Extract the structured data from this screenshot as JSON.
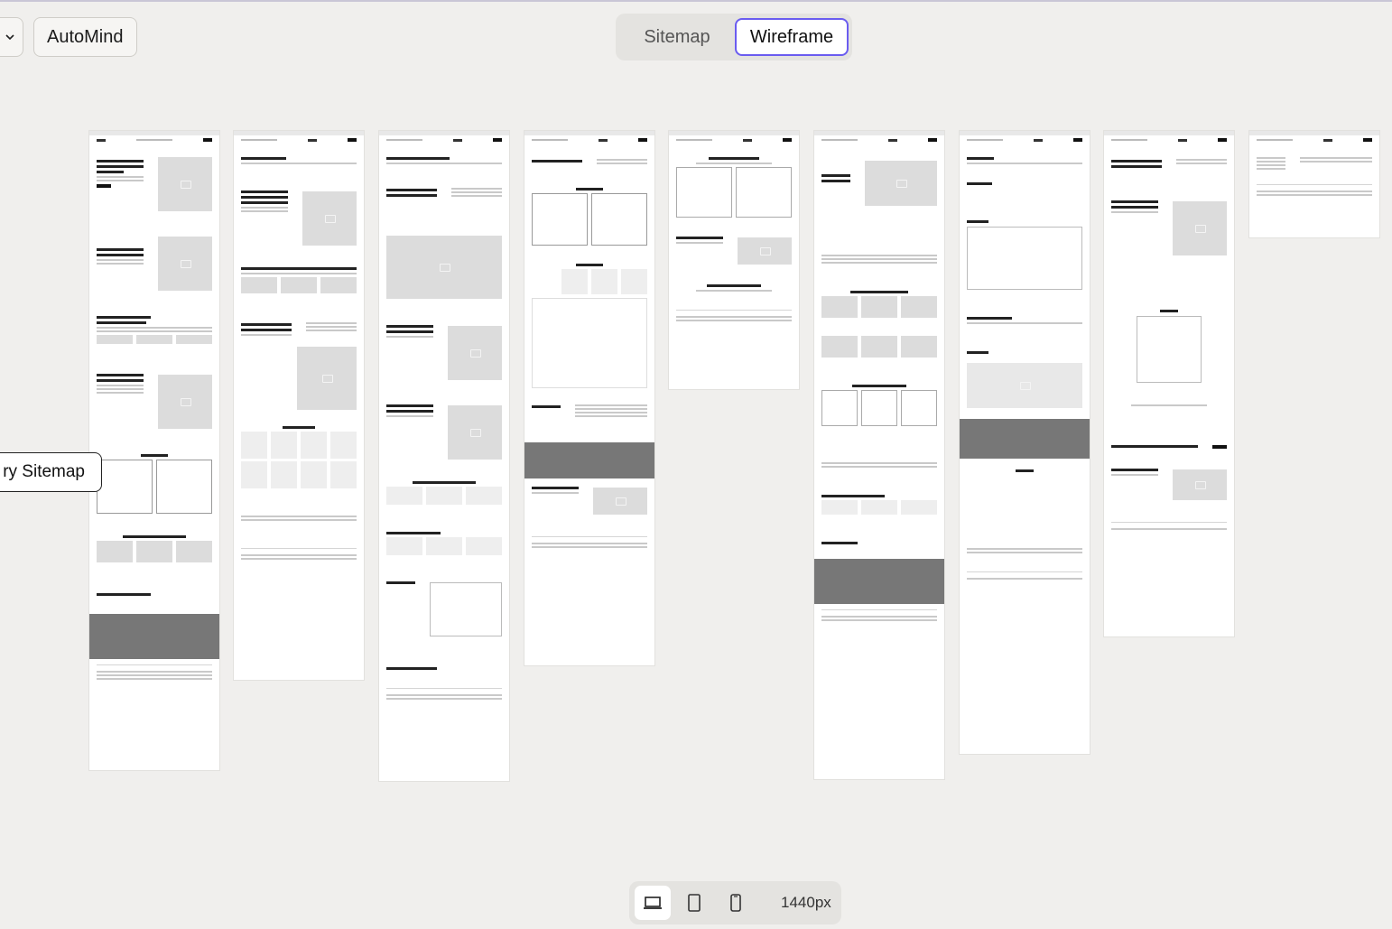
{
  "toolbar": {
    "project_name": "AutoMind",
    "view_tabs": [
      "Sitemap",
      "Wireframe"
    ],
    "active_view": "Wireframe"
  },
  "canvas": {
    "floating_label": "ry Sitemap"
  },
  "device_bar": {
    "devices": [
      "desktop-icon",
      "tablet-icon",
      "mobile-icon"
    ],
    "active_device": "desktop-icon",
    "width_label": "1440px"
  },
  "colors": {
    "accent": "#6a5cf0",
    "background": "#f0efed"
  }
}
